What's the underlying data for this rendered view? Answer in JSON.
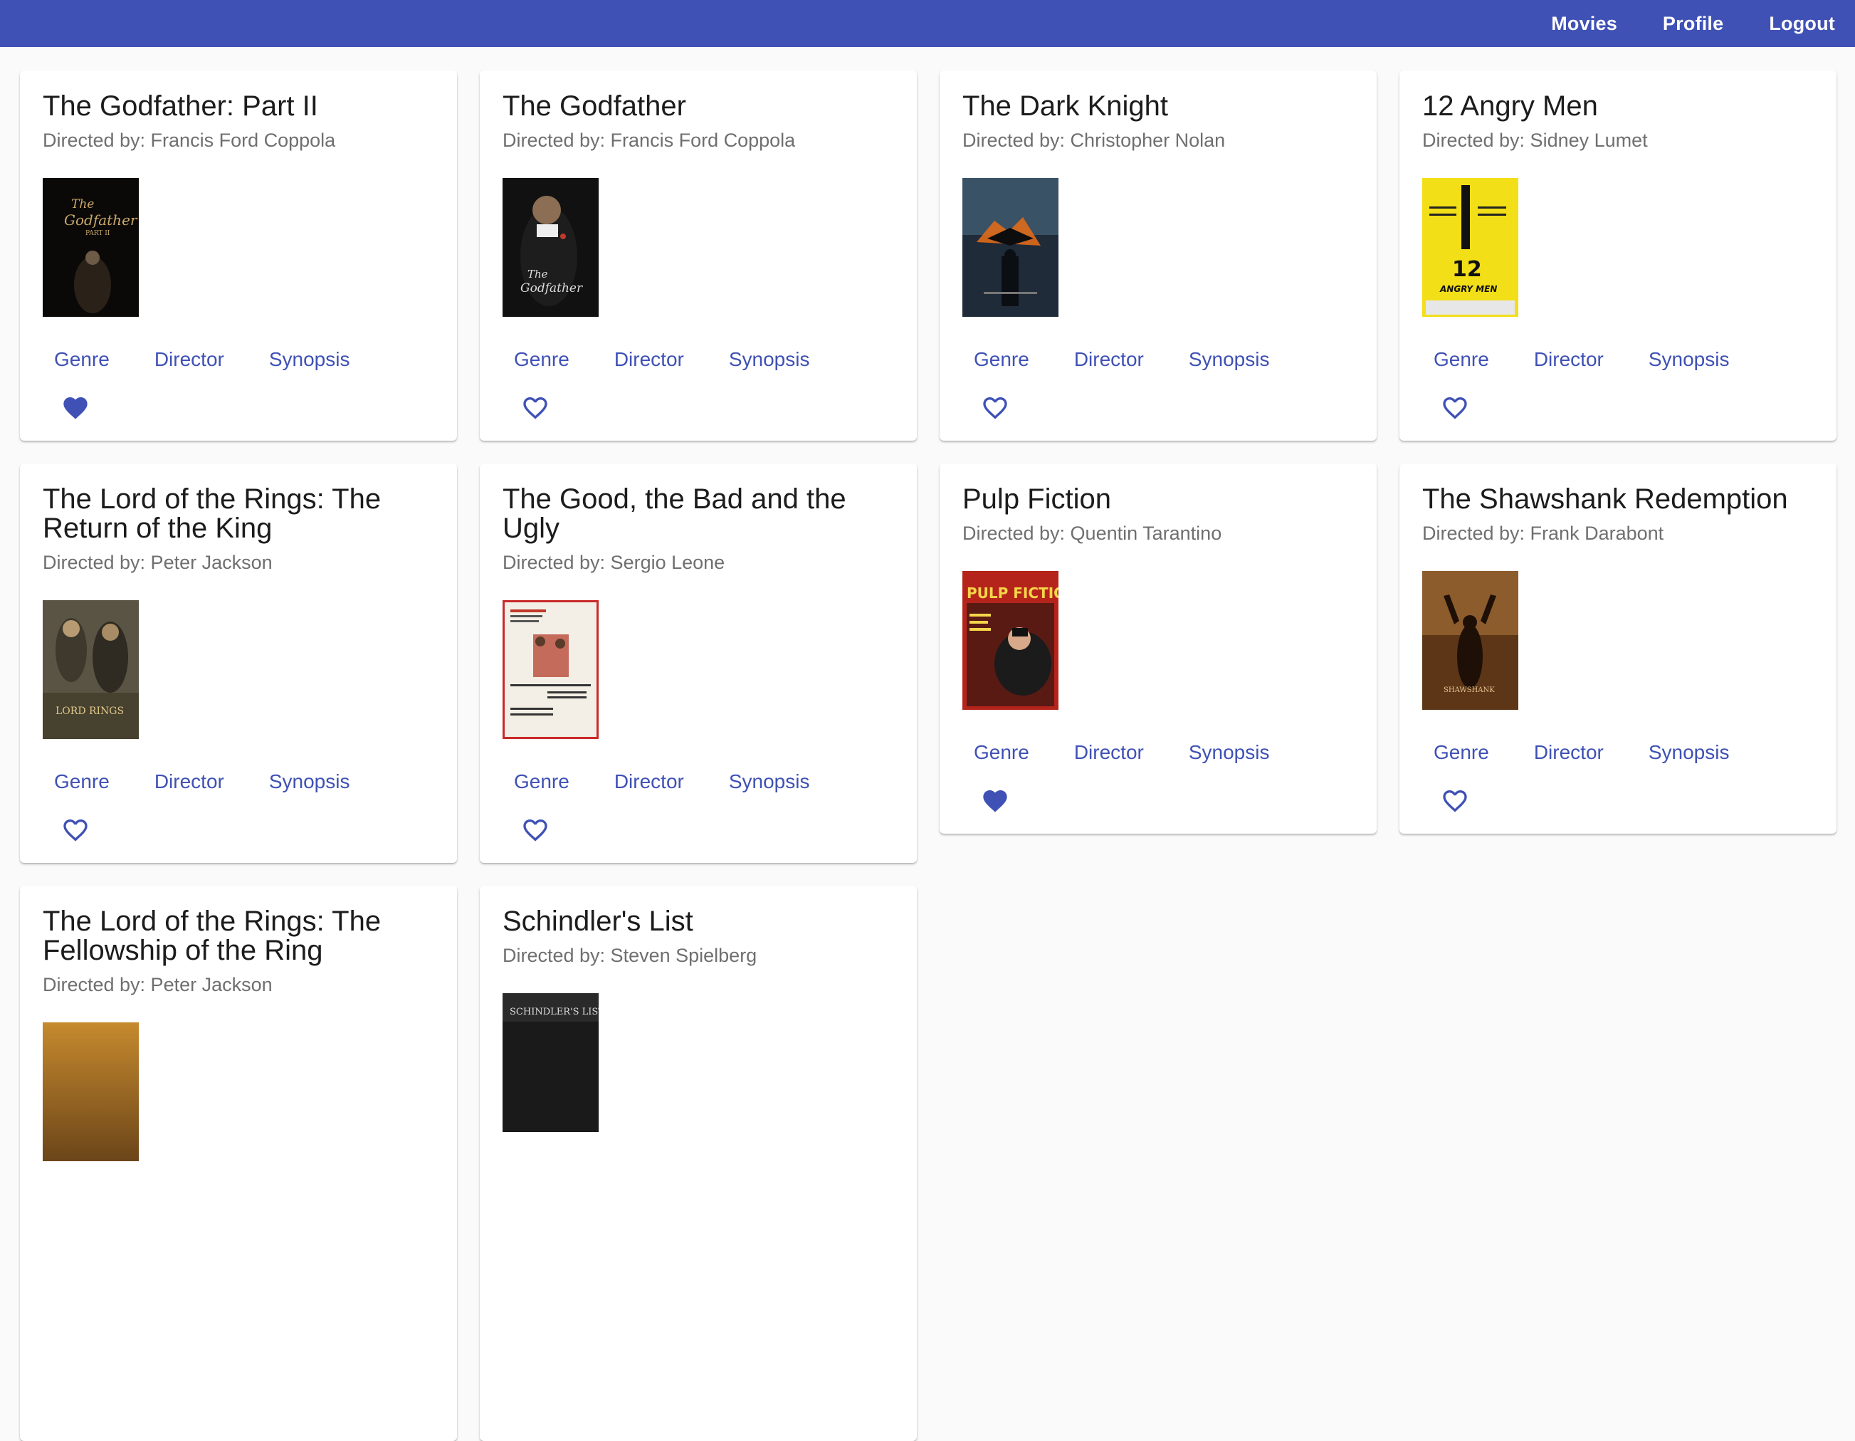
{
  "nav": {
    "movies": "Movies",
    "profile": "Profile",
    "logout": "Logout"
  },
  "theme": {
    "primary": "#3f51b5"
  },
  "movies": [
    {
      "title": "The Godfather: Part II",
      "director": "Directed by: Francis Ford Coppola",
      "genre": "Genre",
      "director_btn": "Director",
      "synopsis": "Synopsis",
      "favorite": true
    },
    {
      "title": "The Godfather",
      "director": "Directed by: Francis Ford Coppola",
      "genre": "Genre",
      "director_btn": "Director",
      "synopsis": "Synopsis",
      "favorite": false
    },
    {
      "title": "The Dark Knight",
      "director": "Directed by: Christopher Nolan",
      "genre": "Genre",
      "director_btn": "Director",
      "synopsis": "Synopsis",
      "favorite": false
    },
    {
      "title": "12 Angry Men",
      "director": "Directed by: Sidney Lumet",
      "genre": "Genre",
      "director_btn": "Director",
      "synopsis": "Synopsis",
      "favorite": false
    },
    {
      "title": "The Lord of the Rings: The Return of the King",
      "director": "Directed by: Peter Jackson",
      "genre": "Genre",
      "director_btn": "Director",
      "synopsis": "Synopsis",
      "favorite": false
    },
    {
      "title": "The Good, the Bad and the Ugly",
      "director": "Directed by: Sergio Leone",
      "genre": "Genre",
      "director_btn": "Director",
      "synopsis": "Synopsis",
      "favorite": false
    },
    {
      "title": "Pulp Fiction",
      "director": "Directed by: Quentin Tarantino",
      "genre": "Genre",
      "director_btn": "Director",
      "synopsis": "Synopsis",
      "favorite": true
    },
    {
      "title": "The Shawshank Redemption",
      "director": "Directed by: Frank Darabont",
      "genre": "Genre",
      "director_btn": "Director",
      "synopsis": "Synopsis",
      "favorite": false
    },
    {
      "title": "The Lord of the Rings: The Fellowship of the Ring",
      "director": "Directed by: Peter Jackson"
    },
    {
      "title": "Schindler's List",
      "director": "Directed by: Steven Spielberg"
    }
  ],
  "poster_text": {
    "godfather2": "The Godfather Part II",
    "godfather": "The Godfather",
    "angry": "12 ANGRY MEN",
    "rotk": "LORD RINGS",
    "pulp": "PULP FICTION",
    "shawshank": "SHAWSHANK",
    "schindler": "SCHINDLER'S LIST"
  },
  "icons": {
    "heart_filled": "heart-filled-icon",
    "heart_outline": "heart-outline-icon"
  }
}
